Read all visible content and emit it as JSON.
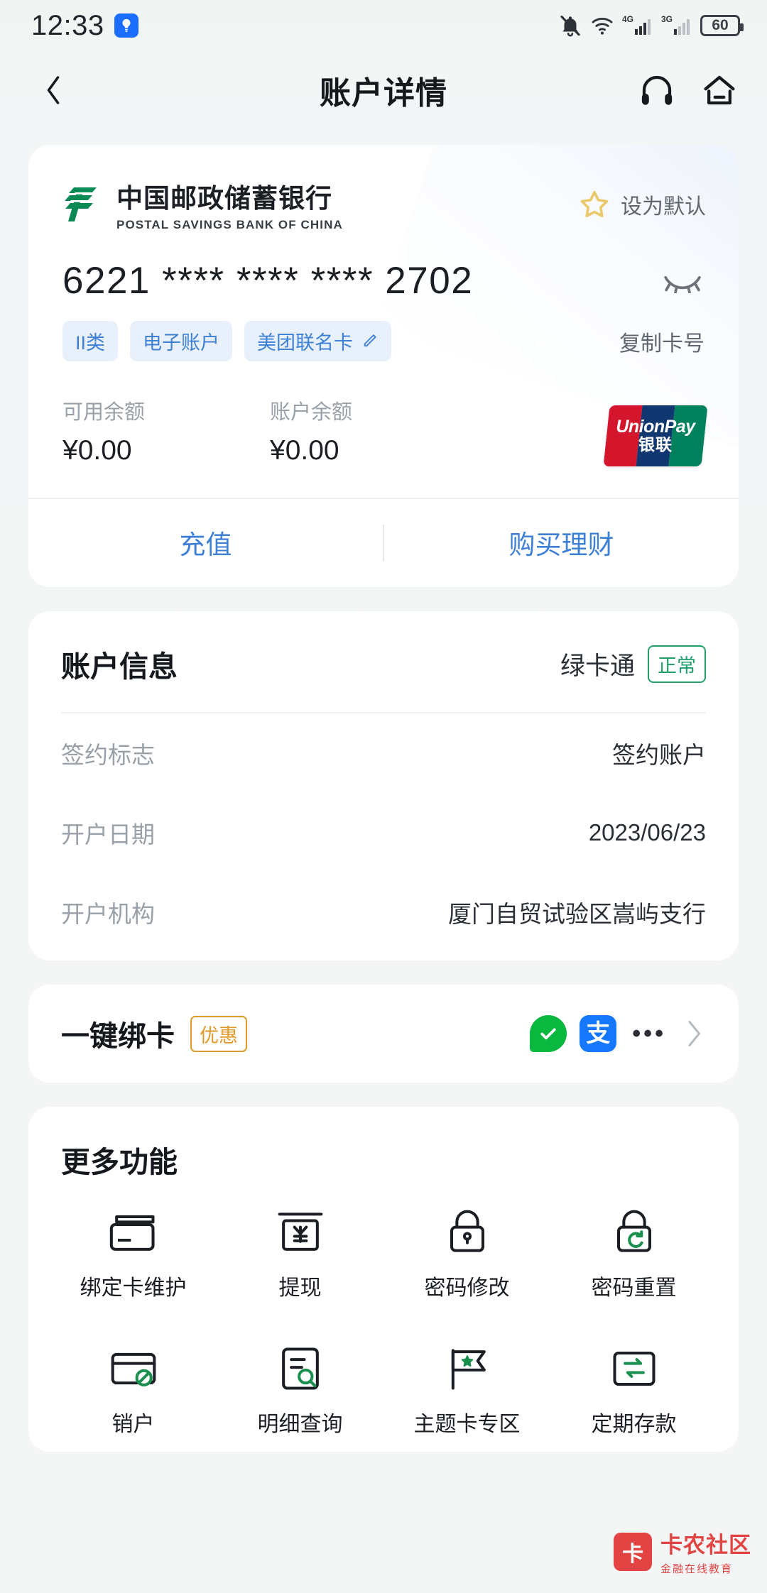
{
  "status_bar": {
    "time": "12:33",
    "battery_level": "60",
    "icons": [
      "flashlight-badge-icon",
      "bell-mute-icon",
      "wifi-icon",
      "signal-4g-icon",
      "signal-3g-icon",
      "battery-icon"
    ],
    "network_4g": "4G",
    "network_3g": "3G"
  },
  "nav": {
    "title": "账户详情",
    "back_icon": "chevron-left-icon",
    "headset_icon": "headset-icon",
    "home_icon": "home-icon"
  },
  "bank_card": {
    "bank_name_cn": "中国邮政储蓄银行",
    "bank_name_en": "POSTAL SAVINGS BANK OF CHINA",
    "set_default_label": "设为默认",
    "star_icon": "star-outline-icon",
    "star_color": "#e9c96a",
    "card_number": "6221 **** **** **** 2702",
    "eye_icon": "eye-closed-icon",
    "chips": [
      "II类",
      "电子账户",
      "美团联名卡"
    ],
    "chip_edit_icon": "pencil-icon",
    "copy_label": "复制卡号",
    "available_label": "可用余额",
    "available_value": "¥0.00",
    "account_label": "账户余额",
    "account_value": "¥0.00",
    "unionpay": {
      "en": "UnionPay",
      "cn": "银联"
    },
    "actions": [
      "充值",
      "购买理财"
    ],
    "accent_color": "#3e80d6"
  },
  "account_info": {
    "title": "账户信息",
    "card_kind": "绿卡通",
    "status": "正常",
    "status_color": "#22a06b",
    "rows": [
      {
        "key": "签约标志",
        "value": "签约账户"
      },
      {
        "key": "开户日期",
        "value": "2023/06/23"
      },
      {
        "key": "开户机构",
        "value": "厦门自贸试验区嵩屿支行"
      }
    ]
  },
  "bind_card": {
    "title": "一键绑卡",
    "tag": "优惠",
    "tag_color": "#e09a2a",
    "pay_icons": [
      "wechat-pay-icon",
      "alipay-icon"
    ],
    "alipay_glyph": "支",
    "more_dots": "•••",
    "chevron_icon": "chevron-right-icon"
  },
  "more_functions": {
    "title": "更多功能",
    "items": [
      {
        "label": "绑定卡维护",
        "icon": "card-maintain-icon"
      },
      {
        "label": "提现",
        "icon": "withdraw-icon"
      },
      {
        "label": "密码修改",
        "icon": "lock-edit-icon"
      },
      {
        "label": "密码重置",
        "icon": "lock-reset-icon"
      },
      {
        "label": "销户",
        "icon": "card-close-icon"
      },
      {
        "label": "明细查询",
        "icon": "detail-search-icon"
      },
      {
        "label": "主题卡专区",
        "icon": "theme-card-icon"
      },
      {
        "label": "定期存款",
        "icon": "deposit-icon"
      }
    ]
  },
  "watermark": {
    "name": "卡农社区",
    "sub": "金融在线教育",
    "color": "#e23b3b"
  }
}
